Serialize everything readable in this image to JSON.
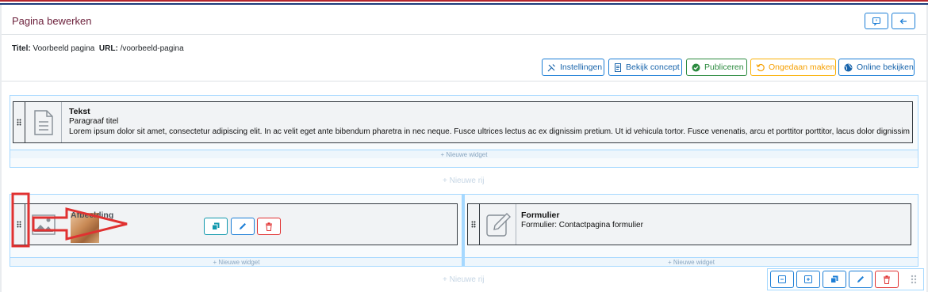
{
  "header": {
    "title": "Pagina bewerken"
  },
  "meta": {
    "title_label": "Titel:",
    "title_value": "Voorbeeld pagina",
    "url_label": "URL:",
    "url_value": "/voorbeeld-pagina"
  },
  "toolbar": {
    "settings": "Instellingen",
    "view_concept": "Bekijk concept",
    "publish": "Publiceren",
    "undo": "Ongedaan maken",
    "view_online": "Online bekijken"
  },
  "rows": [
    {
      "widgets": [
        {
          "type": "Tekst",
          "line1": "Paragraaf titel",
          "line2": "Lorem ipsum dolor sit amet, consectetur adipiscing elit. In ac velit eget ante bibendum pharetra in nec neque. Fusce ultrices lectus ac ex dignissim pretium. Ut id vehicula tortor. Fusce venenatis, arcu et porttitor porttitor, lacus dolor dignissim libero,..."
        }
      ],
      "new_widget": "+ Nieuwe widget"
    },
    {
      "widgets": [
        {
          "type": "Afbeelding"
        },
        {
          "type": "Formulier",
          "line1": "Formulier: Contactpagina formulier"
        }
      ],
      "new_widget": "+ Nieuwe widget"
    }
  ],
  "new_row": "+ Nieuwe rij",
  "colors": {
    "flag_red": "#b3262e",
    "flag_white": "#ffffff",
    "flag_blue": "#1b3a7a",
    "accent": "#1c7ed6",
    "title": "#6b1f3a",
    "annotation": "#e03131"
  }
}
